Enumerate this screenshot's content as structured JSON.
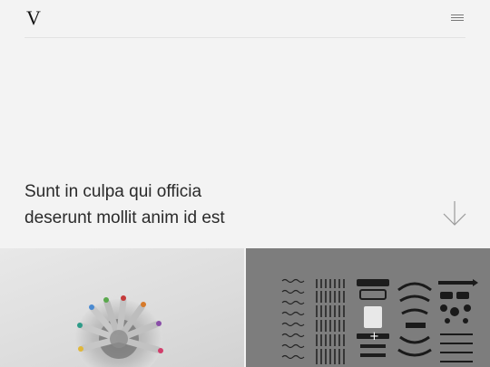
{
  "header": {
    "logo": "V",
    "menu_icon": "hamburger-menu-icon"
  },
  "hero": {
    "line1": "Sunt in culpa qui officia",
    "line2": "deserunt mollit anim id est",
    "scroll_icon": "arrow-down-icon"
  },
  "gallery": {
    "items": [
      {
        "image": "colored-pencils-in-cup"
      },
      {
        "image": "disassembled-typewriter-parts",
        "overlay_icon": "plus-icon"
      }
    ]
  },
  "colors": {
    "background": "#f3f3f3",
    "text": "#2a2a2a",
    "divider": "#e2e2e2",
    "right_tile": "#7d7d7d"
  }
}
